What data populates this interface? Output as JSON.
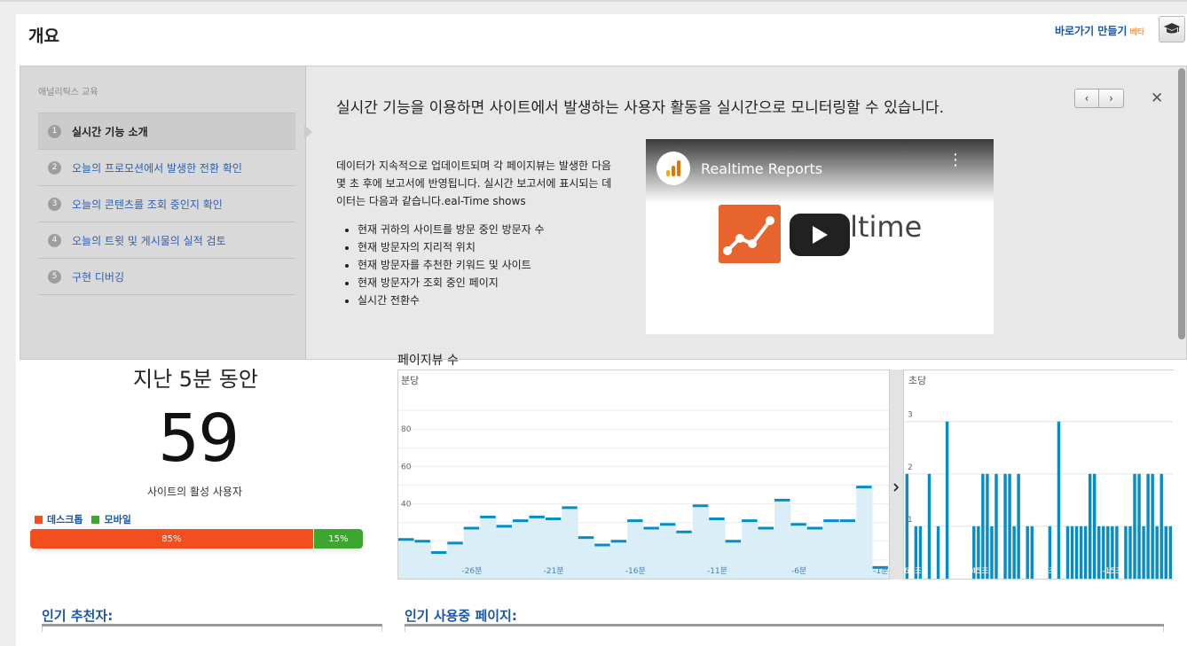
{
  "header": {
    "title": "개요",
    "shortcut_label": "바로가기 만들기",
    "beta_label": "베타"
  },
  "tutorial": {
    "side_title": "애널리틱스 교육",
    "items": [
      {
        "num": "1",
        "label": "실시간 기능 소개"
      },
      {
        "num": "2",
        "label": "오늘의 프로모션에서 발생한 전환 확인"
      },
      {
        "num": "3",
        "label": "오늘의 콘텐츠를 조회 중인지 확인"
      },
      {
        "num": "4",
        "label": "오늘의 트윗 및 게시물의 실적 검토"
      },
      {
        "num": "5",
        "label": "구현 디버깅"
      }
    ],
    "heading": "실시간 기능을 이용하면 사이트에서 발생하는 사용자 활동을 실시간으로 모니터링할 수 있습니다.",
    "prev_icon": "chevron-left-icon",
    "next_icon": "chevron-right-icon",
    "description": "데이터가 지속적으로 업데이트되며 각 페이지뷰는 발생한 다음 몇 초 후에 보고서에 반영됩니다. 실시간 보고서에 표시되는 데이터는 다음과 같습니다.eal-Time shows",
    "bullets": [
      "현재 귀하의 사이트를 방문 중인 방문자 수",
      "현재 방문자의 지리적 위치",
      "현재 방문자를 추천한 키워드 및 사이트",
      "현재 방문자가 조회 중인 페이지",
      "실시간 전환수"
    ],
    "video": {
      "title": "Realtime Reports",
      "overlay_text": "Realtime"
    }
  },
  "summary": {
    "title": "지난 5분 동안",
    "count": "59",
    "caption": "사이트의 활성 사용자",
    "legend": [
      {
        "label": "데스크톱",
        "color": "#f24e1e"
      },
      {
        "label": "모바일",
        "color": "#3ba72e"
      }
    ],
    "desktop_pct": 85,
    "mobile_pct": 15,
    "desktop_label": "85%",
    "mobile_label": "15%"
  },
  "pageviews": {
    "title": "페이지뷰 수",
    "per_minute_label": "분당",
    "per_second_label": "초당",
    "expand_icon": "chevron-right-icon"
  },
  "chart_data": [
    {
      "type": "area",
      "title": "분당",
      "ylim": [
        0,
        100
      ],
      "yticks": [
        "20",
        "40",
        "60",
        "80"
      ],
      "xticks": [
        "-26분",
        "-21분",
        "-16분",
        "-11분",
        "-6분",
        "-1분"
      ],
      "values": [
        21,
        20,
        14,
        19,
        27,
        33,
        28,
        31,
        33,
        32,
        38,
        22,
        18,
        20,
        31,
        27,
        29,
        25,
        39,
        32,
        20,
        31,
        27,
        42,
        29,
        27,
        31,
        31,
        49,
        6
      ],
      "color": "#058dc7"
    },
    {
      "type": "bar",
      "title": "초당",
      "ylim": [
        0,
        3.3
      ],
      "yticks": [
        "1",
        "2",
        "3"
      ],
      "xticks": [
        "-60초",
        "-45초",
        "-30초",
        "-15초"
      ],
      "values": [
        2,
        0,
        1,
        1,
        0,
        2,
        0,
        1,
        0,
        3,
        0,
        0,
        0,
        0,
        0,
        1,
        1,
        2,
        2,
        1,
        2,
        0,
        2,
        2,
        1,
        2,
        0,
        1,
        1,
        0,
        0,
        0,
        1,
        0,
        3,
        0,
        1,
        1,
        1,
        1,
        1,
        2,
        2,
        1,
        1,
        1,
        1,
        1,
        0,
        1,
        1,
        2,
        2,
        1,
        2,
        2,
        1,
        2,
        1,
        1
      ],
      "color": "#058dc7"
    }
  ],
  "bottom": {
    "top_referrers": "인기 추천자:",
    "top_pages": "인기 사용중 페이지:"
  },
  "colors": {
    "link": "#1a56a6",
    "accent": "#e8701a",
    "chart": "#058dc7"
  }
}
